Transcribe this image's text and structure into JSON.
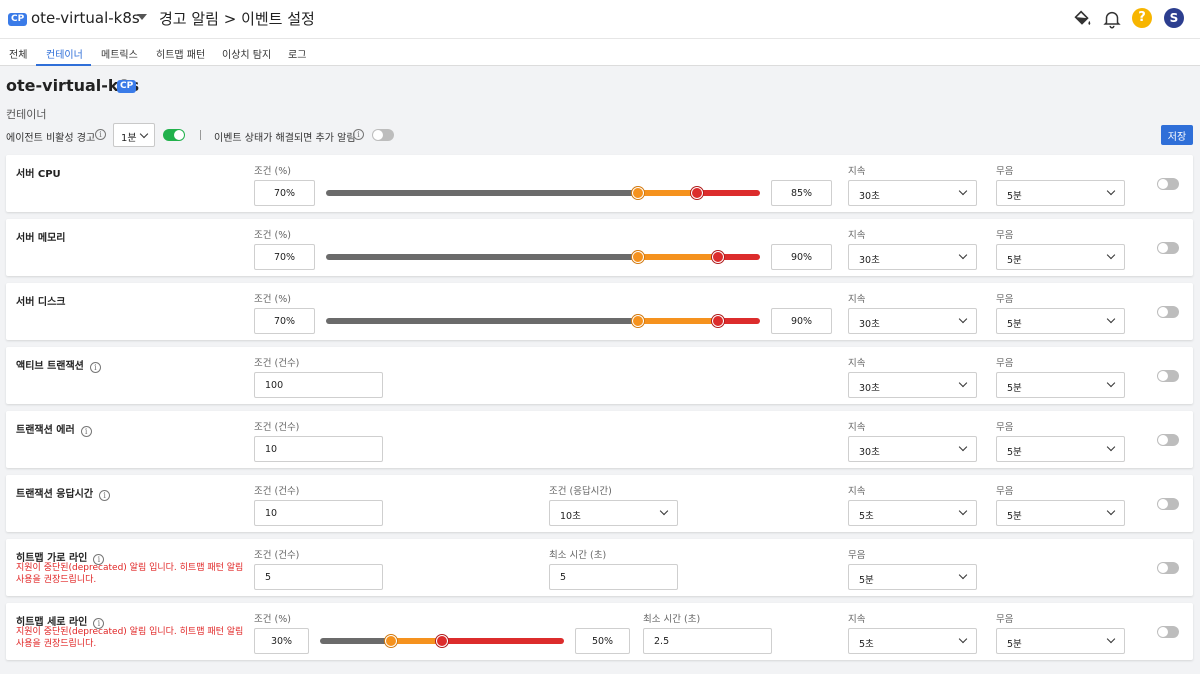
{
  "header": {
    "badge": "CP",
    "project": "ote-virtual-k8s",
    "breadcrumb": "경고 알림 > 이벤트 설정",
    "help_label": "?",
    "avatar_letter": "S",
    "icons": [
      "paint-bucket-icon",
      "bell-icon",
      "help-icon",
      "avatar"
    ]
  },
  "tabs": [
    "전체",
    "컨테이너",
    "메트릭스",
    "히트맵 패턴",
    "이상치 탐지",
    "로그"
  ],
  "active_tab": "컨테이너",
  "page": {
    "title": "ote-virtual-k8s",
    "badge": "CP",
    "section": "컨테이너"
  },
  "controls": {
    "agent_warning_label": "에이전트 비활성 경고",
    "agent_interval": "1분",
    "agent_enabled": true,
    "resolve_label": "이벤트 상태가 해결되면 추가 알림",
    "resolve_enabled": false,
    "save": "저장"
  },
  "colors": {
    "accent": "#2f6fd8",
    "toggle_on": "#22b14c",
    "warning": "#f5921e",
    "critical": "#dc2c2c",
    "warn_text": "#e02424"
  },
  "cards": [
    {
      "title": "서버 CPU",
      "cond_label": "조건 (%)",
      "min": "70%",
      "max": "85%",
      "warn_level": 0.72,
      "crit_level": 0.855,
      "dur_label": "지속",
      "dur": "30초",
      "mute_label": "무음",
      "mute": "5분",
      "enabled": false
    },
    {
      "title": "서버 메모리",
      "cond_label": "조건 (%)",
      "min": "70%",
      "max": "90%",
      "warn_level": 0.72,
      "crit_level": 0.903,
      "dur_label": "지속",
      "dur": "30초",
      "mute_label": "무음",
      "mute": "5분",
      "enabled": false
    },
    {
      "title": "서버 디스크",
      "cond_label": "조건 (%)",
      "min": "70%",
      "max": "90%",
      "warn_level": 0.72,
      "crit_level": 0.903,
      "dur_label": "지속",
      "dur": "30초",
      "mute_label": "무음",
      "mute": "5분",
      "enabled": false
    },
    {
      "title": "액티브 트랜잭션",
      "cond_label": "조건 (건수)",
      "value": "100",
      "dur_label": "지속",
      "dur": "30초",
      "mute_label": "무음",
      "mute": "5분",
      "enabled": false
    },
    {
      "title": "트랜잭션 에러",
      "cond_label": "조건 (건수)",
      "value": "10",
      "dur_label": "지속",
      "dur": "30초",
      "mute_label": "무음",
      "mute": "5분",
      "enabled": false
    },
    {
      "title": "트랜잭션 응답시간",
      "cond_label": "조건 (건수)",
      "value": "10",
      "cond2_label": "조건 (응답시간)",
      "cond2": "10초",
      "dur_label": "지속",
      "dur": "5초",
      "mute_label": "무음",
      "mute": "5분",
      "enabled": false
    },
    {
      "title": "히트맵 가로 라인",
      "warning": "지원이 중단된(deprecated) 알림 입니다. 히트맵 패턴 알림 사용을 권장드립니다.",
      "cond_label": "조건 (건수)",
      "value": "5",
      "min_time_label": "최소 시간 (초)",
      "min_time": "5",
      "mute_label": "무음",
      "mute": "5분",
      "enabled": false
    },
    {
      "title": "히트맵 세로 라인",
      "warning": "지원이 중단된(deprecated) 알림 입니다. 히트맵 패턴 알림 사용을 권장드립니다.",
      "cond_label": "조건 (%)",
      "min": "30%",
      "max": "50%",
      "warn_level": 0.29,
      "crit_level": 0.5,
      "min_time_label": "최소 시간 (초)",
      "min_time": "2.5",
      "dur_label": "지속",
      "dur": "5초",
      "mute_label": "무음",
      "mute": "5분",
      "enabled": false
    }
  ]
}
